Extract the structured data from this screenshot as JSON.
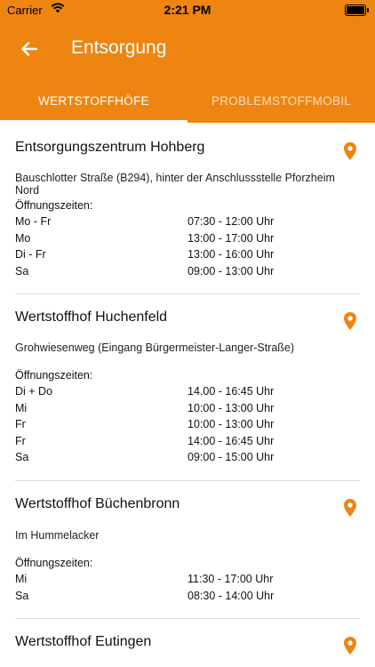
{
  "status": {
    "carrier": "Carrier",
    "time": "2:21 PM"
  },
  "appbar": {
    "title": "Entsorgung"
  },
  "tabs": [
    {
      "label": "WERTSTOFFHÖFE"
    },
    {
      "label": "PROBLEMSTOFFMOBIL"
    }
  ],
  "hours_label": "Öffnungszeiten:",
  "locations": [
    {
      "name": "Entsorgungszentrum Hohberg",
      "address": "Bauschlotter Straße (B294), hinter der Anschlussstelle Pforzheim Nord",
      "hours": [
        {
          "day": "Mo - Fr",
          "time": "07:30 - 12:00 Uhr"
        },
        {
          "day": "Mo",
          "time": "13:00 - 17:00 Uhr"
        },
        {
          "day": "Di - Fr",
          "time": "13:00 - 16:00 Uhr"
        },
        {
          "day": "Sa",
          "time": "09:00 - 13:00 Uhr"
        }
      ]
    },
    {
      "name": "Wertstoffhof Huchenfeld",
      "address": "Grohwiesenweg (Eingang Bürgermeister-Langer-Straße)",
      "hours": [
        {
          "day": "Di + Do",
          "time": "14.00 - 16:45 Uhr"
        },
        {
          "day": "Mi",
          "time": "10:00 - 13:00 Uhr"
        },
        {
          "day": "Fr",
          "time": "10:00 - 13:00 Uhr"
        },
        {
          "day": "Fr",
          "time": "14:00 - 16:45 Uhr"
        },
        {
          "day": "Sa",
          "time": "09:00 - 15:00 Uhr"
        }
      ]
    },
    {
      "name": "Wertstoffhof Büchenbronn",
      "address": "Im Hummelacker",
      "hours": [
        {
          "day": "Mi",
          "time": "11:30 - 17:00 Uhr"
        },
        {
          "day": "Sa",
          "time": "08:30 - 14:00  Uhr"
        }
      ]
    },
    {
      "name": "Wertstoffhof Eutingen",
      "address": "",
      "hours": []
    }
  ],
  "colors": {
    "accent": "#ee8511",
    "pin": "#ee8511"
  }
}
